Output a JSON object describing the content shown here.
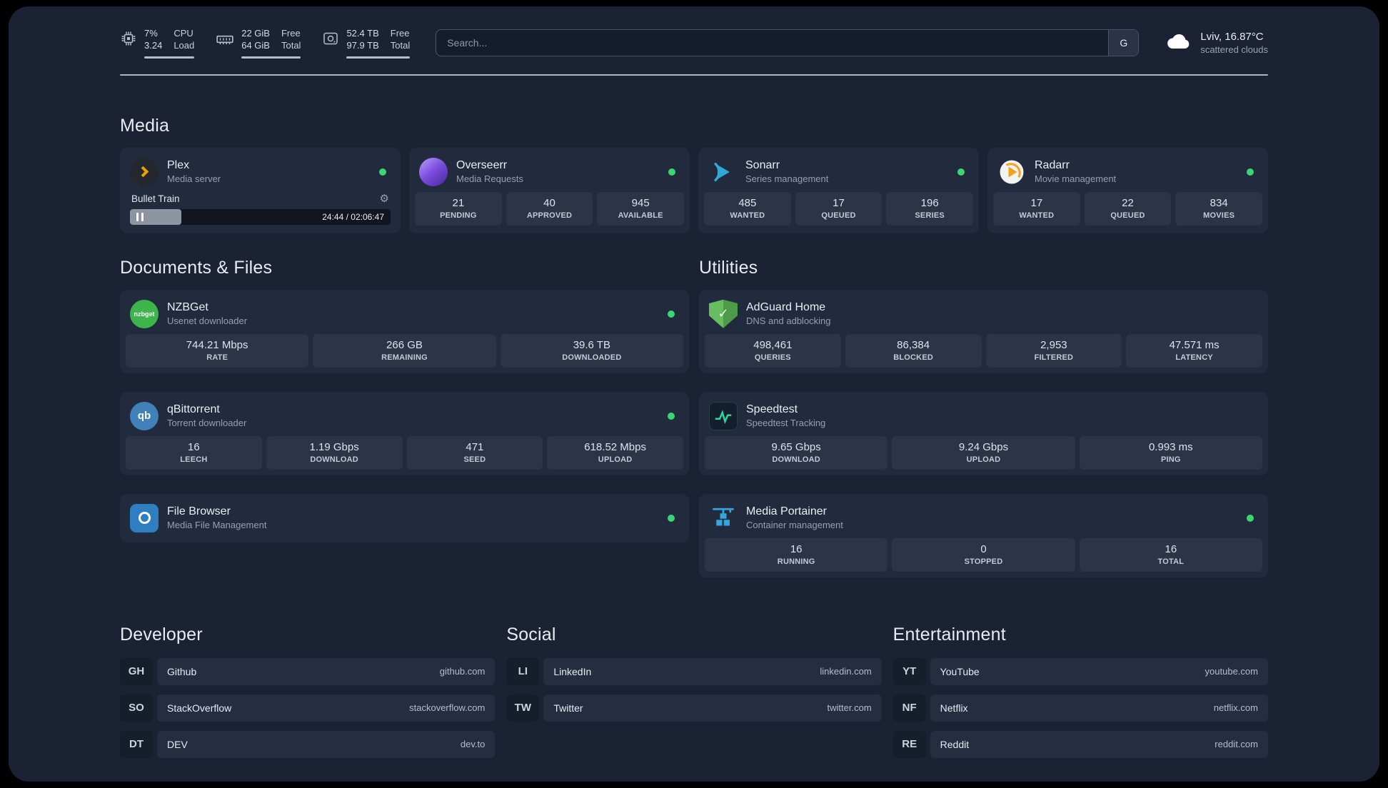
{
  "topbar": {
    "cpu": {
      "value1": "7%",
      "value2": "3.24",
      "label1": "CPU",
      "label2": "Load"
    },
    "memory": {
      "value1": "22 GiB",
      "value2": "64 GiB",
      "label1": "Free",
      "label2": "Total"
    },
    "disk": {
      "value1": "52.4 TB",
      "value2": "97.9 TB",
      "label1": "Free",
      "label2": "Total"
    },
    "search": {
      "placeholder": "Search...",
      "provider": "G"
    },
    "weather": {
      "location": "Lviv, 16.87°C",
      "condition": "scattered clouds"
    }
  },
  "media": {
    "title": "Media",
    "plex": {
      "name": "Plex",
      "desc": "Media server",
      "now_playing": "Bullet Train",
      "time": "24:44 / 02:06:47"
    },
    "overseerr": {
      "name": "Overseerr",
      "desc": "Media Requests",
      "stats": [
        {
          "value": "21",
          "label": "PENDING"
        },
        {
          "value": "40",
          "label": "APPROVED"
        },
        {
          "value": "945",
          "label": "AVAILABLE"
        }
      ]
    },
    "sonarr": {
      "name": "Sonarr",
      "desc": "Series management",
      "stats": [
        {
          "value": "485",
          "label": "WANTED"
        },
        {
          "value": "17",
          "label": "QUEUED"
        },
        {
          "value": "196",
          "label": "SERIES"
        }
      ]
    },
    "radarr": {
      "name": "Radarr",
      "desc": "Movie management",
      "stats": [
        {
          "value": "17",
          "label": "WANTED"
        },
        {
          "value": "22",
          "label": "QUEUED"
        },
        {
          "value": "834",
          "label": "MOVIES"
        }
      ]
    }
  },
  "documents": {
    "title": "Documents & Files",
    "nzbget": {
      "name": "NZBGet",
      "desc": "Usenet downloader",
      "stats": [
        {
          "value": "744.21 Mbps",
          "label": "RATE"
        },
        {
          "value": "266 GB",
          "label": "REMAINING"
        },
        {
          "value": "39.6 TB",
          "label": "DOWNLOADED"
        }
      ]
    },
    "qbittorrent": {
      "name": "qBittorrent",
      "desc": "Torrent downloader",
      "stats": [
        {
          "value": "16",
          "label": "LEECH"
        },
        {
          "value": "1.19 Gbps",
          "label": "DOWNLOAD"
        },
        {
          "value": "471",
          "label": "SEED"
        },
        {
          "value": "618.52 Mbps",
          "label": "UPLOAD"
        }
      ]
    },
    "filebrowser": {
      "name": "File Browser",
      "desc": "Media File Management"
    }
  },
  "utilities": {
    "title": "Utilities",
    "adguard": {
      "name": "AdGuard Home",
      "desc": "DNS and adblocking",
      "stats": [
        {
          "value": "498,461",
          "label": "QUERIES"
        },
        {
          "value": "86,384",
          "label": "BLOCKED"
        },
        {
          "value": "2,953",
          "label": "FILTERED"
        },
        {
          "value": "47.571 ms",
          "label": "LATENCY"
        }
      ]
    },
    "speedtest": {
      "name": "Speedtest",
      "desc": "Speedtest Tracking",
      "stats": [
        {
          "value": "9.65 Gbps",
          "label": "DOWNLOAD"
        },
        {
          "value": "9.24 Gbps",
          "label": "UPLOAD"
        },
        {
          "value": "0.993 ms",
          "label": "PING"
        }
      ]
    },
    "portainer": {
      "name": "Media Portainer",
      "desc": "Container management",
      "stats": [
        {
          "value": "16",
          "label": "RUNNING"
        },
        {
          "value": "0",
          "label": "STOPPED"
        },
        {
          "value": "16",
          "label": "TOTAL"
        }
      ]
    }
  },
  "bookmarks": [
    {
      "title": "Developer",
      "items": [
        {
          "abbr": "GH",
          "name": "Github",
          "url": "github.com"
        },
        {
          "abbr": "SO",
          "name": "StackOverflow",
          "url": "stackoverflow.com"
        },
        {
          "abbr": "DT",
          "name": "DEV",
          "url": "dev.to"
        }
      ]
    },
    {
      "title": "Social",
      "items": [
        {
          "abbr": "LI",
          "name": "LinkedIn",
          "url": "linkedin.com"
        },
        {
          "abbr": "TW",
          "name": "Twitter",
          "url": "twitter.com"
        }
      ]
    },
    {
      "title": "Entertainment",
      "items": [
        {
          "abbr": "YT",
          "name": "YouTube",
          "url": "youtube.com"
        },
        {
          "abbr": "NF",
          "name": "Netflix",
          "url": "netflix.com"
        },
        {
          "abbr": "RE",
          "name": "Reddit",
          "url": "reddit.com"
        }
      ]
    }
  ],
  "icons": {
    "gear": "⚙",
    "check": "✓",
    "nzbget_label": "nzbget",
    "qb_label": "qb"
  },
  "colors": {
    "background": "#1a2233",
    "card": "#222b3d",
    "tile": "#2b3547",
    "status_online": "#3bd671",
    "plex_accent": "#e8a00c",
    "adguard_green": "#67bd5f",
    "speedtest_green": "#34d399",
    "portainer_blue": "#37a5dd",
    "sonarr_blue": "#2fa8dc",
    "radarr_orange": "#f7a01b"
  }
}
